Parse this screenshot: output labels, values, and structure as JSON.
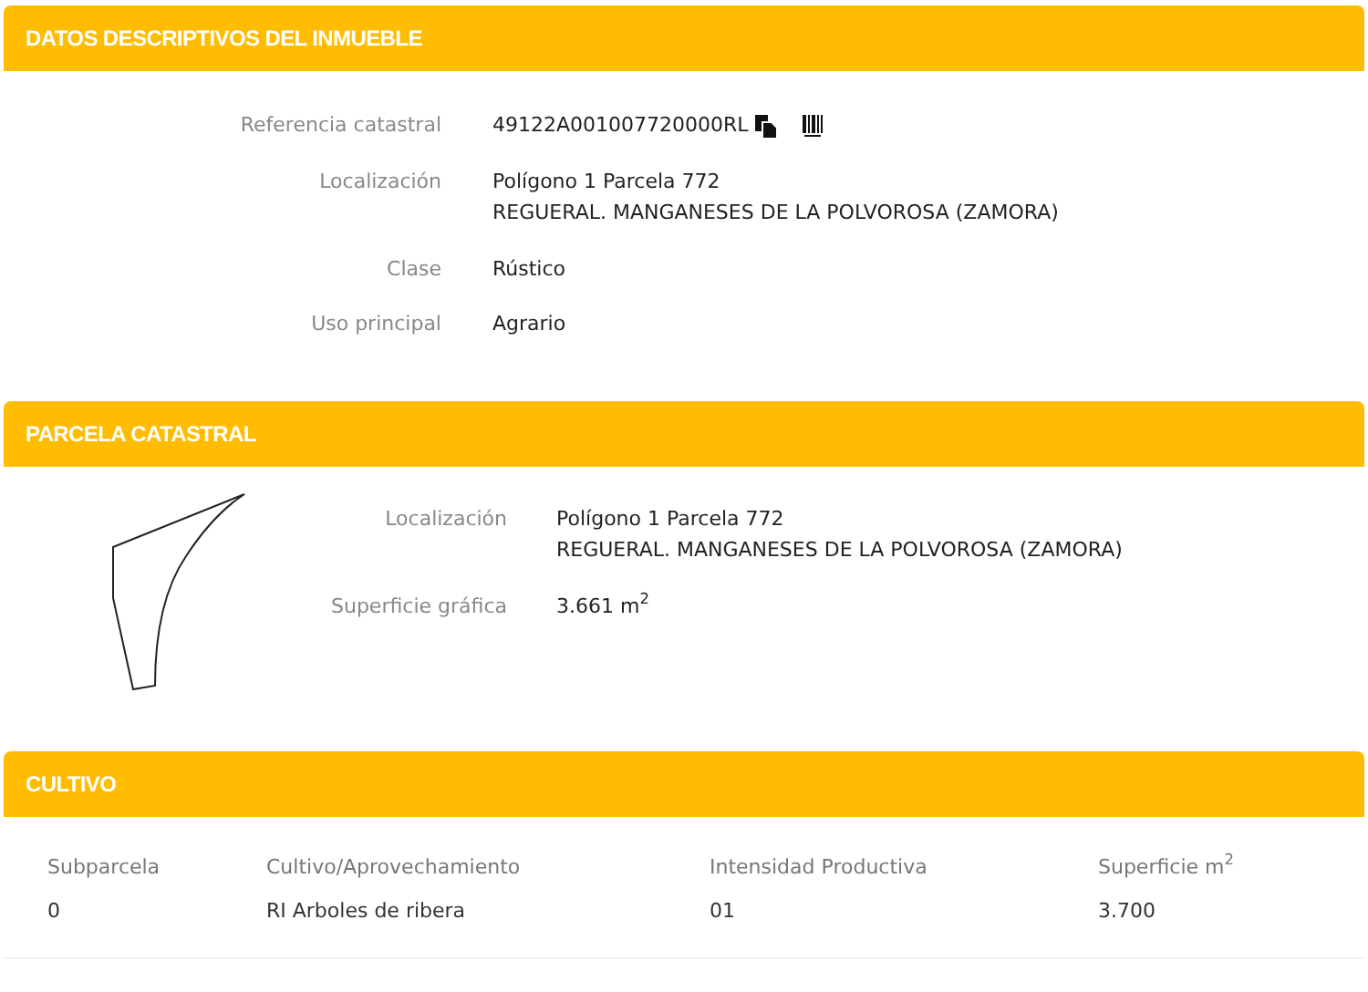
{
  "sections": [
    {
      "title": "DATOS DESCRIPTIVOS DEL INMUEBLE",
      "kind": "fields",
      "fields": [
        {
          "label": "Referencia catastral",
          "lines": [
            "49122A001007720000RL"
          ],
          "icons": true
        },
        {
          "label": "Localización",
          "lines": [
            "Polígono 1 Parcela 772",
            "REGUERAL. MANGANESES DE LA POLVOROSA (ZAMORA)"
          ]
        },
        {
          "label": "Clase",
          "lines": [
            "Rústico"
          ]
        },
        {
          "label": "Uso principal",
          "lines": [
            "Agrario"
          ]
        }
      ]
    },
    {
      "title": "PARCELA CATASTRAL",
      "kind": "parcel",
      "fields": [
        {
          "label": "Localización",
          "lines": [
            "Polígono 1 Parcela 772",
            "REGUERAL. MANGANESES DE LA POLVOROSA (ZAMORA)"
          ]
        },
        {
          "label": "Superficie gráfica",
          "lines": [
            "3.661 m$^{2}$"
          ]
        }
      ]
    },
    {
      "title": "CULTIVO",
      "kind": "table",
      "columns": [
        "Subparcela",
        "Cultivo/Aprovechamiento",
        "Intensidad Productiva",
        "Superficie m$^{2}$"
      ],
      "rows": [
        [
          "0",
          "RI Arboles de ribera",
          "01",
          "3.700"
        ]
      ]
    }
  ]
}
